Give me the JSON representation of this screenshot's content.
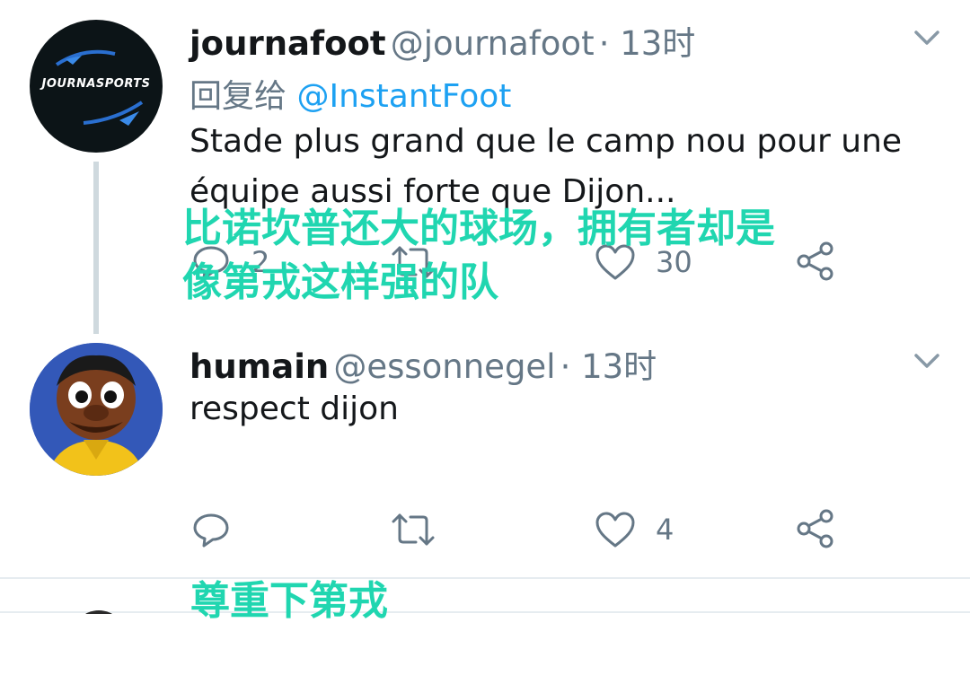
{
  "tweet1": {
    "avatar_text": "JOURNASPORTS",
    "name": "journafoot",
    "handle": "@journafoot",
    "time": "· 13时",
    "reply_label": "回复给",
    "reply_mention": "@InstantFoot",
    "text_line1": "Stade plus grand que le camp nou pour une",
    "text_line2": "équipe aussi forte que Dijon...",
    "reply_count": "2",
    "like_count": "30"
  },
  "tweet2": {
    "name": "humain",
    "handle": "@essonnegel",
    "time": "· 13时",
    "text": "respect dijon",
    "like_count": "4"
  },
  "overlays": {
    "translation1_line1": "比诺坎普还大的球场，拥有者却是",
    "translation1_line2": "像第戎这样强的队",
    "translation2": "尊重下第戎"
  },
  "colors": {
    "accent": "#1da1f2",
    "muted": "#657786",
    "overlay": "#20d6b0",
    "divider": "#e1e8ed"
  },
  "icons": [
    "reply-icon",
    "retweet-icon",
    "like-icon",
    "share-icon",
    "chevron-down-icon"
  ]
}
